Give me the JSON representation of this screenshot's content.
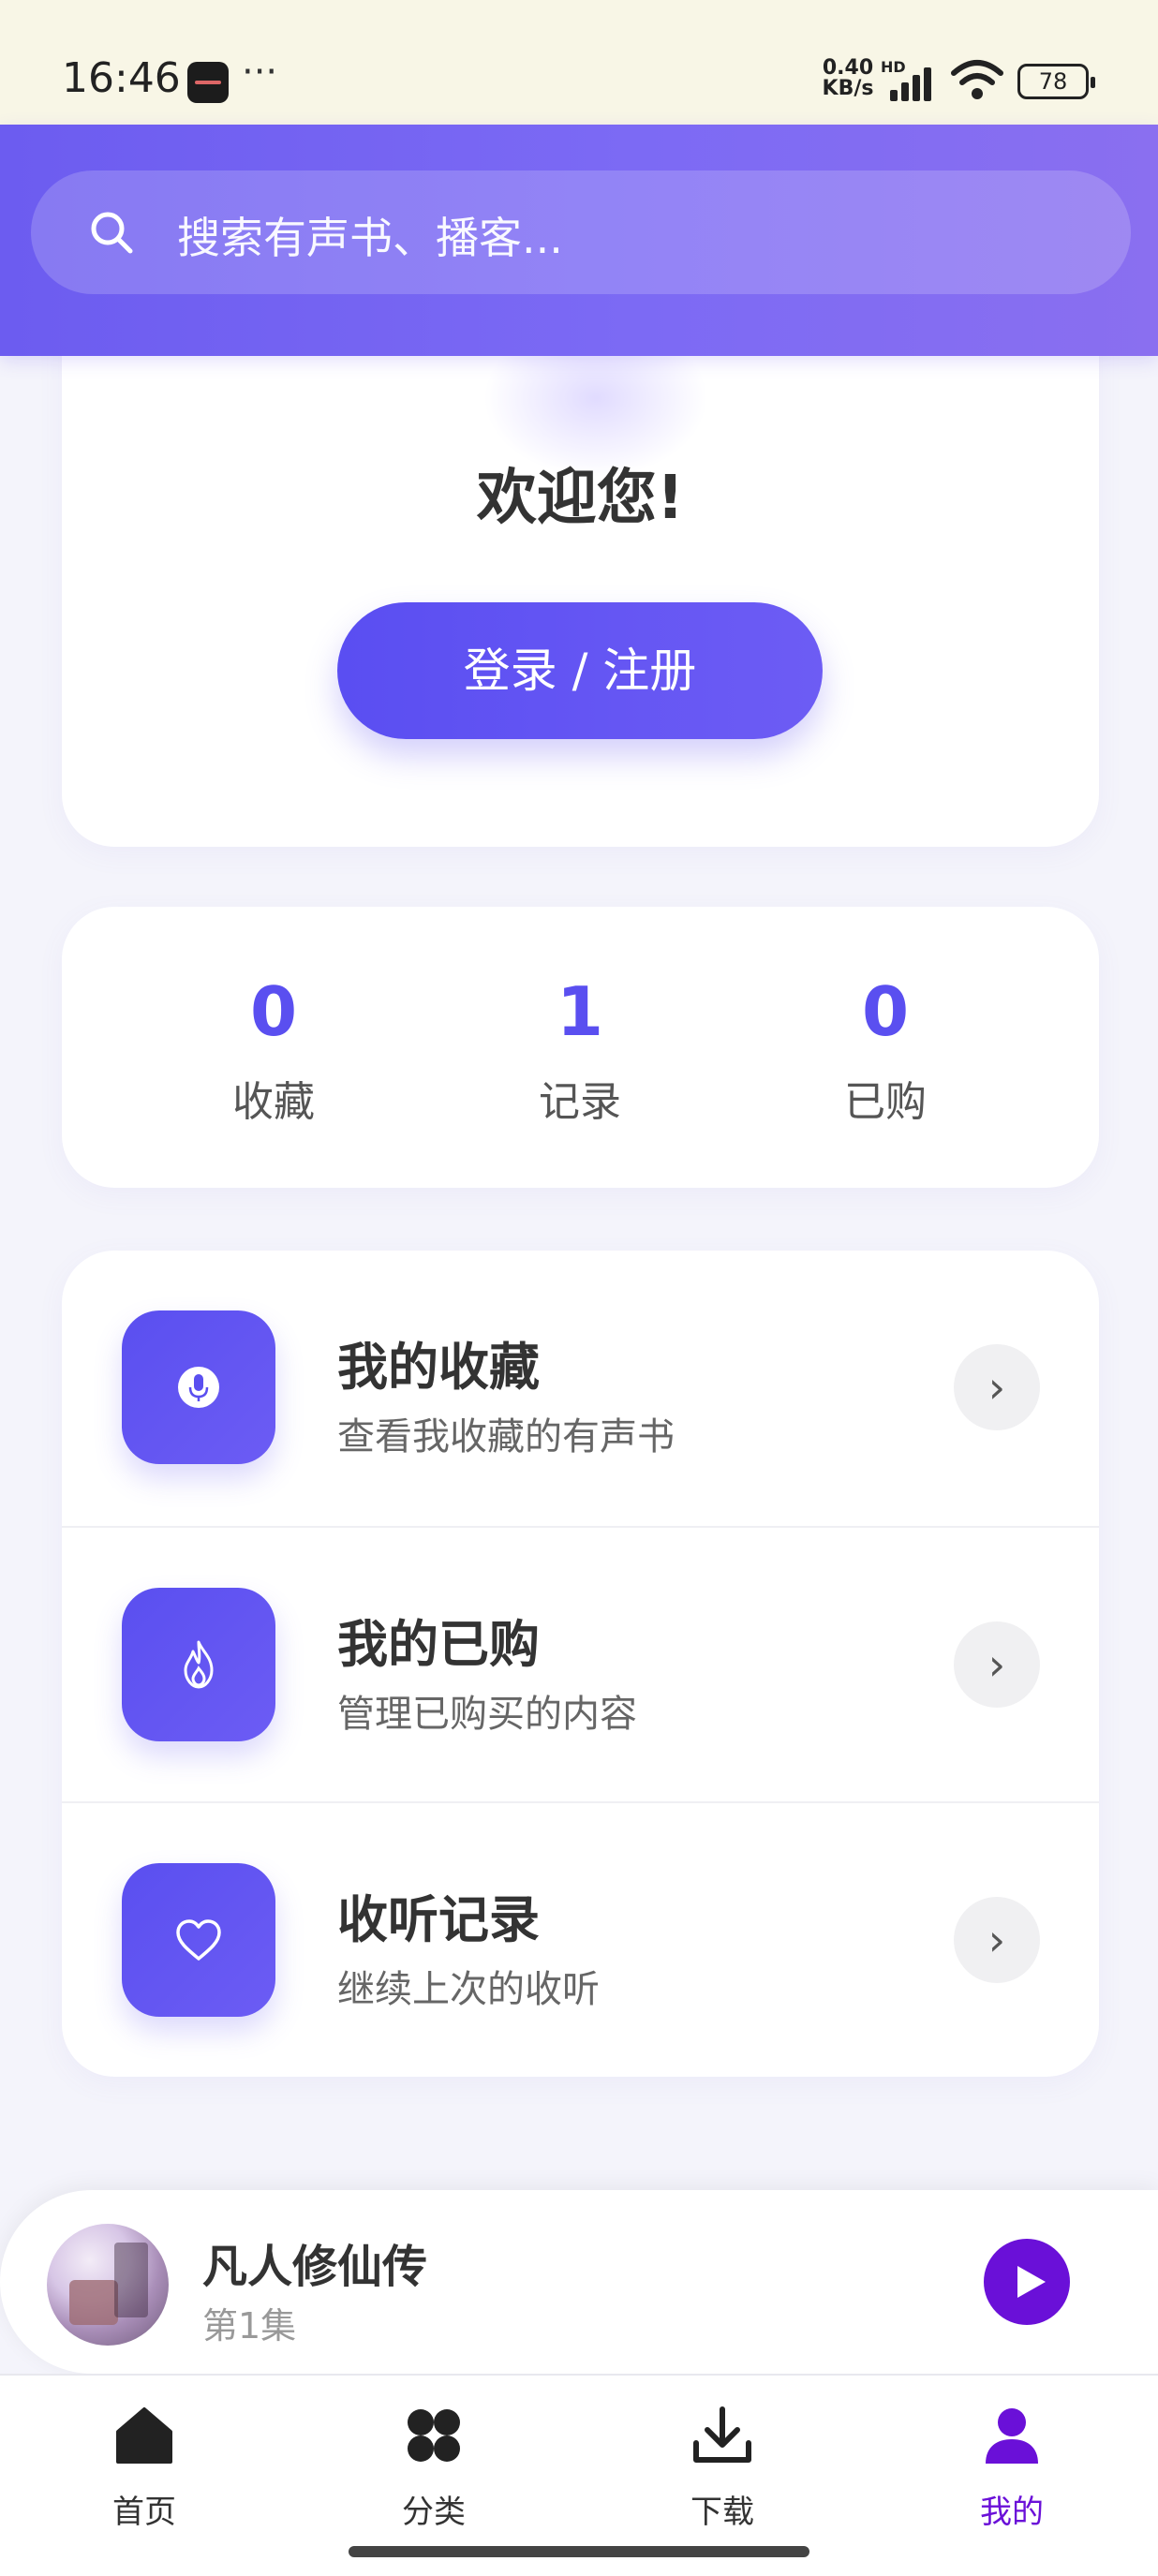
{
  "status_bar": {
    "time": "16:46",
    "more": "···",
    "net_speed_value": "0.40",
    "net_speed_unit": "KB/s",
    "hd": "HD",
    "battery": "78"
  },
  "search": {
    "placeholder": "搜索有声书、播客..."
  },
  "welcome": {
    "title": "欢迎您!",
    "login_label": "登录 / 注册"
  },
  "stats": [
    {
      "value": "0",
      "label": "收藏"
    },
    {
      "value": "1",
      "label": "记录"
    },
    {
      "value": "0",
      "label": "已购"
    }
  ],
  "menu": [
    {
      "title": "我的收藏",
      "subtitle": "查看我收藏的有声书",
      "icon": "microphone-icon"
    },
    {
      "title": "我的已购",
      "subtitle": "管理已购买的内容",
      "icon": "fire-icon"
    },
    {
      "title": "收听记录",
      "subtitle": "继续上次的收听",
      "icon": "heart-icon"
    }
  ],
  "arrow": "›",
  "player": {
    "title": "凡人修仙传",
    "episode": "第1集"
  },
  "tabs": [
    {
      "label": "首页",
      "icon": "home-icon"
    },
    {
      "label": "分类",
      "icon": "category-icon"
    },
    {
      "label": "下载",
      "icon": "download-icon"
    },
    {
      "label": "我的",
      "icon": "user-icon",
      "active": true
    }
  ],
  "colors": {
    "accent": "#5a4ff0",
    "header": "#7466f2",
    "play": "#6a10d8"
  }
}
